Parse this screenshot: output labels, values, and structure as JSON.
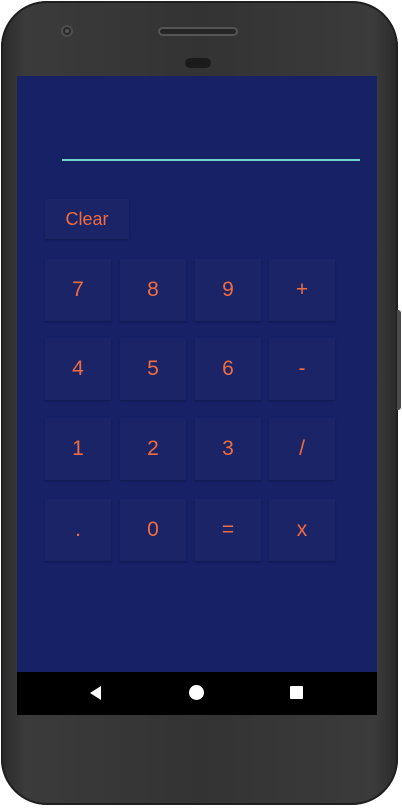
{
  "app": {
    "clear_label": "Clear",
    "keys": [
      [
        "7",
        "8",
        "9",
        "+"
      ],
      [
        "4",
        "5",
        "6",
        "-"
      ],
      [
        "1",
        "2",
        "3",
        "/"
      ],
      [
        ".",
        "0",
        "=",
        "x"
      ]
    ]
  },
  "colors": {
    "screen_bg": "#172166",
    "key_bg": "#1a2466",
    "key_text": "#f26b3f",
    "display_underline": "#6fd6c9"
  },
  "nav": {
    "back_icon": "back-triangle-icon",
    "home_icon": "home-circle-icon",
    "recents_icon": "recents-square-icon"
  }
}
